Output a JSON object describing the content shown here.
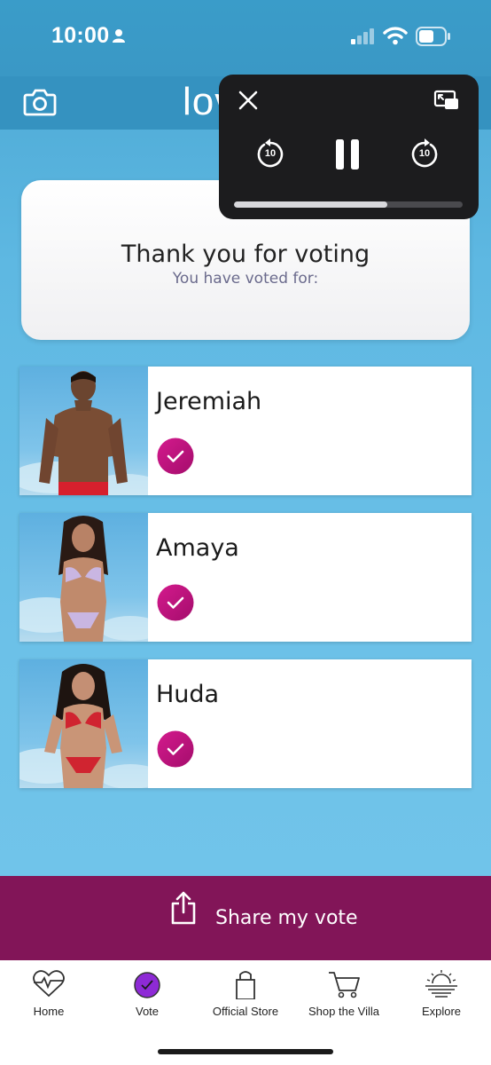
{
  "status_bar": {
    "time": "10:00",
    "icons": [
      "person-icon",
      "signal-icon",
      "wifi-icon",
      "battery-icon"
    ]
  },
  "header": {
    "logo_text": "lov",
    "icons": [
      "camera-icon"
    ]
  },
  "pip_player": {
    "skip_back_label": "10",
    "skip_forward_label": "10",
    "progress": 0.67,
    "icons": [
      "close-icon",
      "expand-icon",
      "skip-back-icon",
      "pause-icon",
      "skip-forward-icon"
    ]
  },
  "thanks": {
    "title": "Thank you for voting",
    "subtitle": "You have voted for:"
  },
  "contestants": [
    {
      "name": "Jeremiah"
    },
    {
      "name": "Amaya"
    },
    {
      "name": "Huda"
    }
  ],
  "share": {
    "label": "Share my vote",
    "icon": "share-icon"
  },
  "tabs": [
    {
      "label": "Home",
      "icon": "heart-pulse-icon"
    },
    {
      "label": "Vote",
      "icon": "vote-check-icon"
    },
    {
      "label": "Official Store",
      "icon": "shopping-bag-icon"
    },
    {
      "label": "Shop the Villa",
      "icon": "cart-icon"
    },
    {
      "label": "Explore",
      "icon": "sunset-icon"
    }
  ],
  "colors": {
    "accent": "#821558",
    "check": "#c4137e",
    "vote_tab": "#8e2ad6",
    "background": "#6cc1e8"
  }
}
